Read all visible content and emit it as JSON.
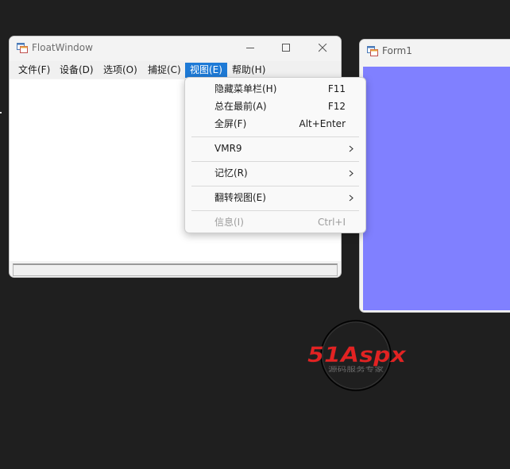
{
  "float_window": {
    "title": "FloatWindow",
    "menu": [
      {
        "label": "文件(F)"
      },
      {
        "label": "设备(D)"
      },
      {
        "label": "选项(O)"
      },
      {
        "label": "捕捉(C)"
      },
      {
        "label": "视图(E)"
      },
      {
        "label": "帮助(H)"
      }
    ]
  },
  "view_menu": {
    "items": [
      {
        "label": "隐藏菜单栏(H)",
        "shortcut": "F11"
      },
      {
        "label": "总在最前(A)",
        "shortcut": "F12"
      },
      {
        "label": "全屏(F)",
        "shortcut": "Alt+Enter"
      },
      {
        "label": "VMR9",
        "submenu": true
      },
      {
        "label": "记忆(R)",
        "submenu": true
      },
      {
        "label": "翻转视图(E)",
        "submenu": true
      },
      {
        "label": "信息(I)",
        "shortcut": "Ctrl+I",
        "disabled": true
      }
    ]
  },
  "form1": {
    "title": "Form1",
    "client_color": "#8080ff"
  },
  "watermark": {
    "brand": "51Aspx",
    "tagline": "源码服务专家"
  },
  "colors": {
    "desktop": "#1f1f1f",
    "accent": "#1e7ad6",
    "brand_red": "#e32222",
    "brand_green": "#3fae3f"
  }
}
